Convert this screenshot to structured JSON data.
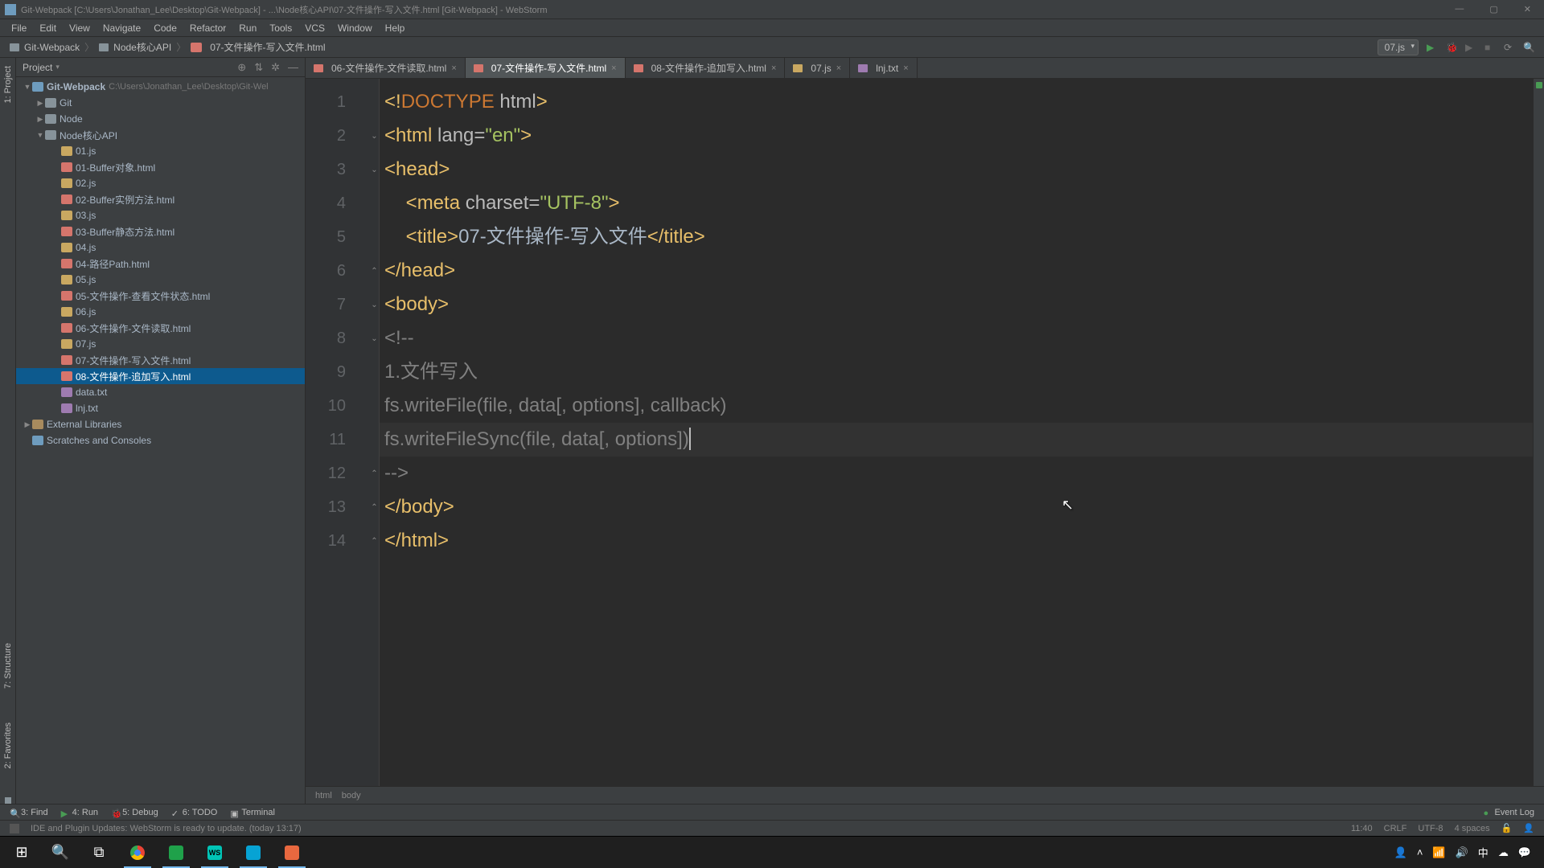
{
  "titlebar": {
    "text": "Git-Webpack [C:\\Users\\Jonathan_Lee\\Desktop\\Git-Webpack] - ...\\Node核心API\\07-文件操作-写入文件.html [Git-Webpack] - WebStorm"
  },
  "menu": {
    "items": [
      "File",
      "Edit",
      "View",
      "Navigate",
      "Code",
      "Refactor",
      "Run",
      "Tools",
      "VCS",
      "Window",
      "Help"
    ]
  },
  "nav": {
    "crumb_project": "Git-Webpack",
    "crumb_folder": "Node核心API",
    "crumb_file": "07-文件操作-写入文件.html",
    "run_config": "07.js"
  },
  "project_panel": {
    "title": "Project",
    "root": "Git-Webpack",
    "root_hint": "C:\\Users\\Jonathan_Lee\\Desktop\\Git-Wel",
    "folders": {
      "git": "Git",
      "node": "Node",
      "nodeapi": "Node核心API"
    },
    "files": [
      "01.js",
      "01-Buffer对象.html",
      "02.js",
      "02-Buffer实例方法.html",
      "03.js",
      "03-Buffer静态方法.html",
      "04.js",
      "04-路径Path.html",
      "05.js",
      "05-文件操作-查看文件状态.html",
      "06.js",
      "06-文件操作-文件读取.html",
      "07.js",
      "07-文件操作-写入文件.html",
      "08-文件操作-追加写入.html",
      "data.txt",
      "lnj.txt"
    ],
    "external": "External Libraries",
    "scratches": "Scratches and Consoles"
  },
  "tabs": [
    {
      "label": "06-文件操作-文件读取.html",
      "type": "html",
      "active": false
    },
    {
      "label": "07-文件操作-写入文件.html",
      "type": "html",
      "active": true
    },
    {
      "label": "08-文件操作-追加写入.html",
      "type": "html",
      "active": false
    },
    {
      "label": "07.js",
      "type": "js",
      "active": false
    },
    {
      "label": "lnj.txt",
      "type": "txt",
      "active": false
    }
  ],
  "code": {
    "lines": [
      {
        "n": 1,
        "html": "<span class='c-tag'>&lt;!</span><span class='c-entity'>DOCTYPE </span><span class='c-attr'>html</span><span class='c-tag'>&gt;</span>"
      },
      {
        "n": 2,
        "html": "<span class='c-tag'>&lt;html </span><span class='c-attr'>lang=</span><span class='c-str'>\"en\"</span><span class='c-tag'>&gt;</span>"
      },
      {
        "n": 3,
        "html": "<span class='c-tag'>&lt;head&gt;</span>"
      },
      {
        "n": 4,
        "html": "    <span class='c-tag'>&lt;meta </span><span class='c-attr'>charset=</span><span class='c-str'>\"UTF-8\"</span><span class='c-tag'>&gt;</span>"
      },
      {
        "n": 5,
        "html": "    <span class='c-tag'>&lt;title&gt;</span><span class='c-txt'>07-文件操作-写入文件</span><span class='c-tag'>&lt;/title&gt;</span>"
      },
      {
        "n": 6,
        "html": "<span class='c-tag'>&lt;/head&gt;</span>"
      },
      {
        "n": 7,
        "html": "<span class='c-tag'>&lt;body&gt;</span>"
      },
      {
        "n": 8,
        "html": "<span class='c-comment'>&lt;!--</span>"
      },
      {
        "n": 9,
        "html": "<span class='c-comment'>1.文件写入</span>"
      },
      {
        "n": 10,
        "html": "<span class='c-comment'>fs.writeFile(file, data[, options], callback)</span>",
        "warn": true
      },
      {
        "n": 11,
        "html": "<span class='c-comment'>fs.writeFileSync(file, data[, options])</span>",
        "caret": true,
        "active": true
      },
      {
        "n": 12,
        "html": "<span class='c-comment'>--&gt;</span>"
      },
      {
        "n": 13,
        "html": "<span class='c-tag'>&lt;/body&gt;</span>"
      },
      {
        "n": 14,
        "html": "<span class='c-tag'>&lt;/html&gt;</span>"
      }
    ]
  },
  "breadcrumb": {
    "items": [
      "html",
      "body"
    ]
  },
  "bottom_bar": {
    "find": "3: Find",
    "run": "4: Run",
    "debug": "5: Debug",
    "todo": "6: TODO",
    "terminal": "Terminal",
    "event_log": "Event Log"
  },
  "status_bar": {
    "msg": "IDE and Plugin Updates: WebStorm is ready to update. (today 13:17)",
    "pos": "11:40",
    "lineend": "CRLF",
    "encoding": "UTF-8",
    "indent": "4 spaces"
  },
  "taskbar": {
    "tray": {
      "ime": "中",
      "cloud": "☁"
    }
  }
}
